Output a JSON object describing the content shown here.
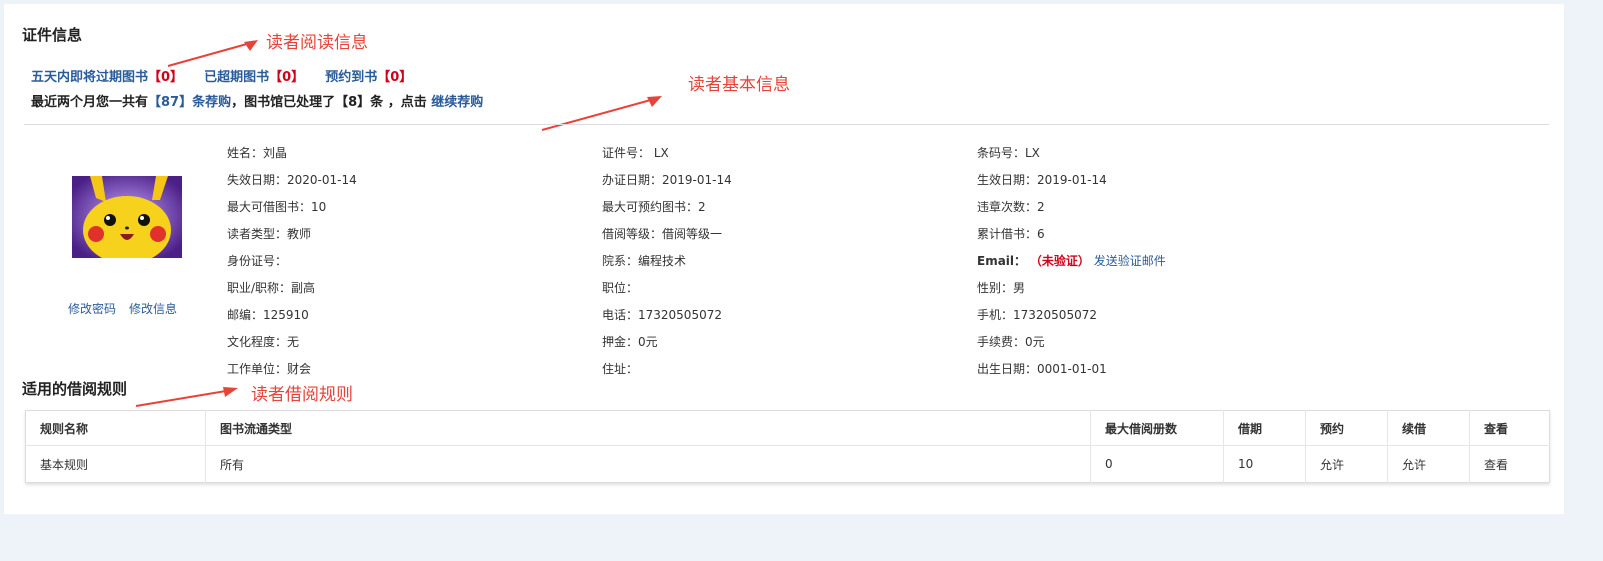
{
  "certificate": {
    "title": "证件信息"
  },
  "reading": {
    "expiring_label": "五天内即将过期图书",
    "expiring_count": "【0】",
    "overdue_label": "已超期图书",
    "overdue_count": "【0】",
    "reserved_label": "预约到书",
    "reserved_count": "【0】",
    "purchase_prefix": "最近两个月您一共有",
    "purchase_count": "【87】",
    "purchase_link": "条荐购",
    "purchase_middle": "，图书馆已处理了【8】条 ，点击",
    "continue_link": "继续荐购"
  },
  "annotations": {
    "reading_info": "读者阅读信息",
    "basic_info": "读者基本信息",
    "borrow_rules": "读者借阅规则"
  },
  "avatar": {
    "change_password": "修改密码",
    "change_info": "修改信息"
  },
  "info": {
    "col1": [
      "姓名：刘晶",
      "失效日期：2020-01-14",
      "最大可借图书：10",
      "读者类型：教师",
      "身份证号：",
      "职业/职称：副高",
      "邮编：125910",
      "文化程度：无",
      "工作单位：财会"
    ],
    "col2": [
      "证件号： LX",
      "办证日期：2019-01-14",
      "最大可预约图书：2",
      "借阅等级：借阅等级一",
      "院系：编程技术",
      "职位：",
      "电话：17320505072",
      "押金：0元",
      "住址："
    ],
    "col3": [
      "条码号：LX",
      "生效日期：2019-01-14",
      "违章次数：2",
      "累计借书：6",
      "",
      "性别：男",
      "手机：17320505072",
      "手续费：0元",
      "出生日期：0001-01-01"
    ],
    "email_label": "Email：",
    "email_status": "（未验证）",
    "email_link": "发送验证邮件"
  },
  "rules": {
    "title": "适用的借阅规则",
    "headers": [
      "规则名称",
      "图书流通类型",
      "最大借阅册数",
      "借期",
      "预约",
      "续借",
      "查看"
    ],
    "rows": [
      [
        "基本规则",
        "所有",
        "0",
        "10",
        "允许",
        "允许",
        "查看"
      ]
    ]
  },
  "colors": {
    "link": "#2a5c9a",
    "red": "#d0021b",
    "annotation": "#e8433a",
    "page_bg": "#eef3f9"
  },
  "icons": [
    "pikachu-avatar"
  ]
}
